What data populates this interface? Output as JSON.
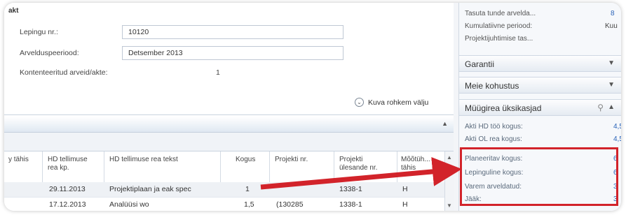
{
  "contract": {
    "title": "akt",
    "fields": [
      {
        "label": "Lepingu nr.:",
        "value": "10120"
      },
      {
        "label": "Arvelduspeeriood:",
        "value": "Detsember 2013"
      }
    ],
    "confirmed_label": "Kontenteeritud arveid/akte:",
    "confirmed_value": "1",
    "more_link": "Kuva rohkem välju"
  },
  "table": {
    "columns": [
      "y tähis",
      "HD tellimuse rea kp.",
      "HD tellimuse rea tekst",
      "Kogus",
      "Projekti nr.",
      "Projekti ülesande nr.",
      "Mõõtüh... tähis"
    ],
    "rows": [
      [
        "",
        "29.11.2013",
        "Projektiplaan ja eak spec",
        "1",
        "",
        "1338-1",
        "H"
      ],
      [
        "",
        "17.12.2013",
        "Analüüsi wo",
        "1,5",
        "(130285",
        "1338-1",
        "H"
      ]
    ]
  },
  "sidebar": {
    "top_lines": [
      {
        "label": "Tasuta tunde arvelda...",
        "value": "8"
      },
      {
        "label": "Kumulatiivne periood:",
        "value": "Kuu"
      },
      {
        "label": "Projektijuhtimise tas...",
        "value": ""
      }
    ],
    "sections": [
      "Garantii",
      "Meie kohustus",
      "Müügirea üksikasjad"
    ],
    "detail_items": [
      {
        "label": "Akti HD töö kogus:",
        "value": "4,5"
      },
      {
        "label": "Akti OL rea kogus:",
        "value": "4,5"
      },
      {
        "label": "Planeeritav kogus:",
        "value": "6"
      },
      {
        "label": "Lepinguline kogus:",
        "value": "6"
      },
      {
        "label": "Varem arveldatud:",
        "value": "3"
      },
      {
        "label": "Jääk:",
        "value": "3"
      }
    ]
  },
  "colors": {
    "highlight": "#d2232a",
    "link": "#2a63b8"
  }
}
